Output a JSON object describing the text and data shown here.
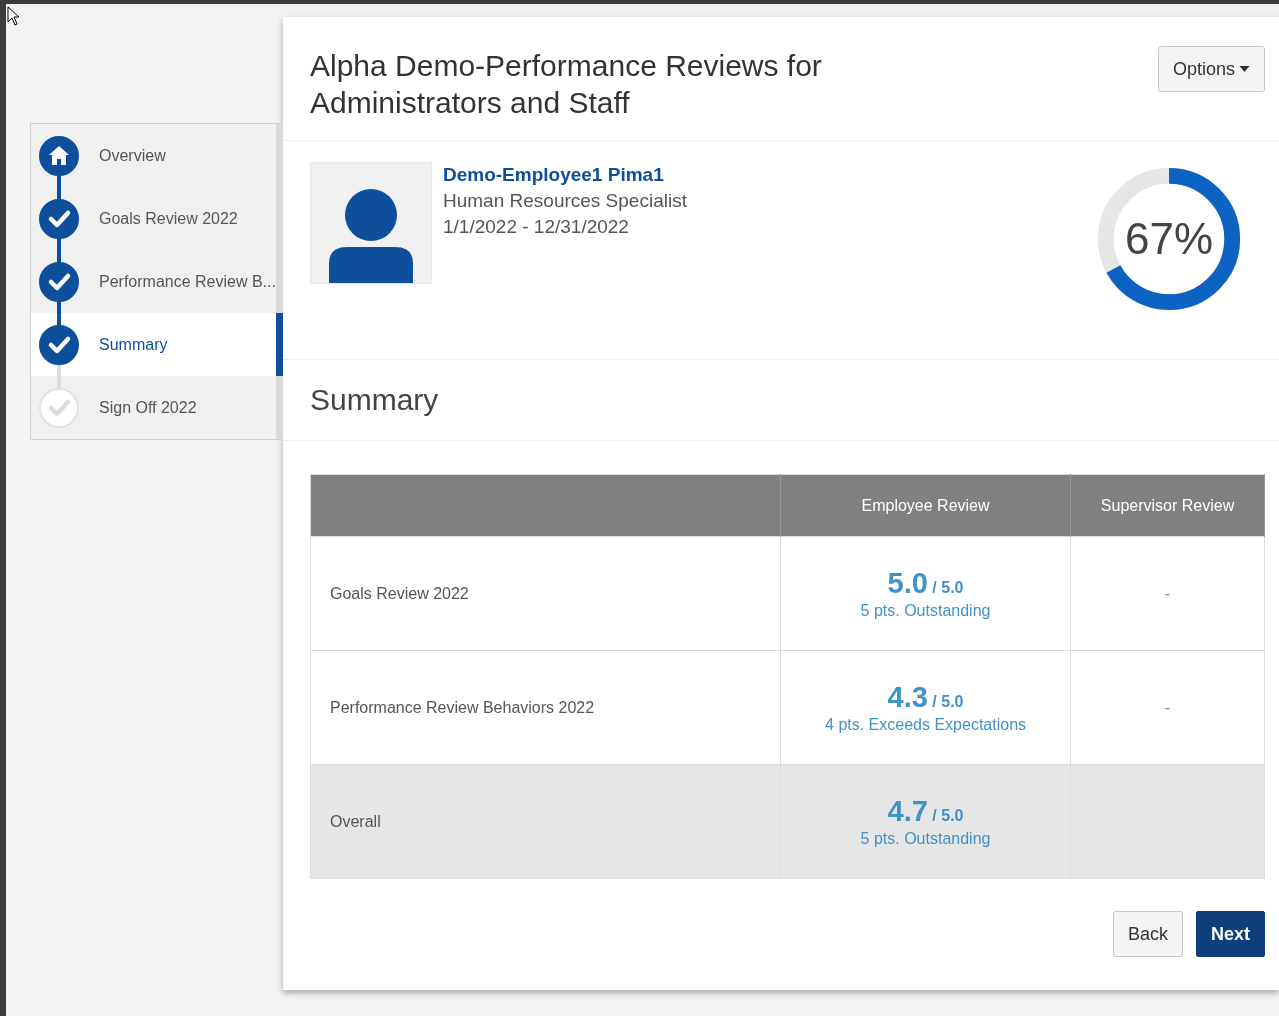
{
  "steps": [
    {
      "kind": "home",
      "label": "Overview",
      "done": true,
      "selected": false
    },
    {
      "kind": "check",
      "label": "Goals Review 2022",
      "done": true,
      "selected": false
    },
    {
      "kind": "check",
      "label": "Performance Review B...",
      "done": true,
      "selected": false
    },
    {
      "kind": "check",
      "label": "Summary",
      "done": true,
      "selected": true
    },
    {
      "kind": "check",
      "label": "Sign Off 2022",
      "done": false,
      "selected": false
    }
  ],
  "title": "Alpha Demo-Performance Reviews for Administrators and Staff",
  "options_button": "Options",
  "employee": {
    "name": "Demo-Employee1 Pima1",
    "job_title": "Human Resources Specialist",
    "period": "1/1/2022 - 12/31/2022"
  },
  "progress": {
    "level": 0.67,
    "reading": "67%"
  },
  "section_title": "Summary",
  "table": {
    "columns": [
      "Employee Review",
      "Supervisor Review"
    ],
    "rows": [
      {
        "kind": "item",
        "label": "Goals Review 2022",
        "score": "5.0",
        "out_of": "/ 5.0",
        "rating": "5 pts. Outstanding",
        "supervisor": "-"
      },
      {
        "kind": "item",
        "label": "Performance Review Behaviors 2022",
        "score": "4.3",
        "out_of": "/ 5.0",
        "rating": "4 pts. Exceeds Expectations",
        "supervisor": "-"
      },
      {
        "kind": "total",
        "label": "Overall",
        "score": "4.7",
        "out_of": "/ 5.0",
        "rating": "5 pts. Outstanding"
      }
    ]
  },
  "buttons": [
    {
      "kind": "secondary",
      "label": "Back"
    },
    {
      "kind": "primary",
      "label": "Next"
    }
  ]
}
